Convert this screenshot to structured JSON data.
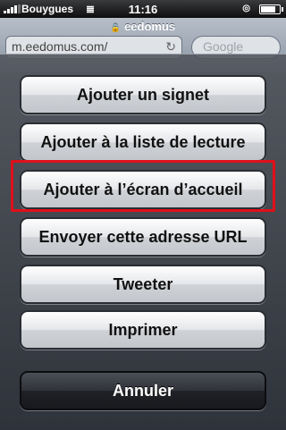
{
  "status_bar": {
    "carrier": "Bouygues",
    "time": "11:16",
    "wifi_icon": "wifi-icon",
    "lock_icon": "lock-icon",
    "battery_level": 0.85
  },
  "browser": {
    "page_title": "eedomus",
    "url": "m.eedomus.com/",
    "search_placeholder": "Google"
  },
  "action_sheet": {
    "items": [
      {
        "label": "Ajouter un signet"
      },
      {
        "label": "Ajouter à la liste de lecture"
      },
      {
        "label": "Ajouter à l’écran d’accueil",
        "highlighted": true
      },
      {
        "label": "Envoyer cette adresse URL"
      },
      {
        "label": "Tweeter"
      },
      {
        "label": "Imprimer"
      }
    ],
    "cancel_label": "Annuler",
    "highlight_color": "#e0101a"
  }
}
